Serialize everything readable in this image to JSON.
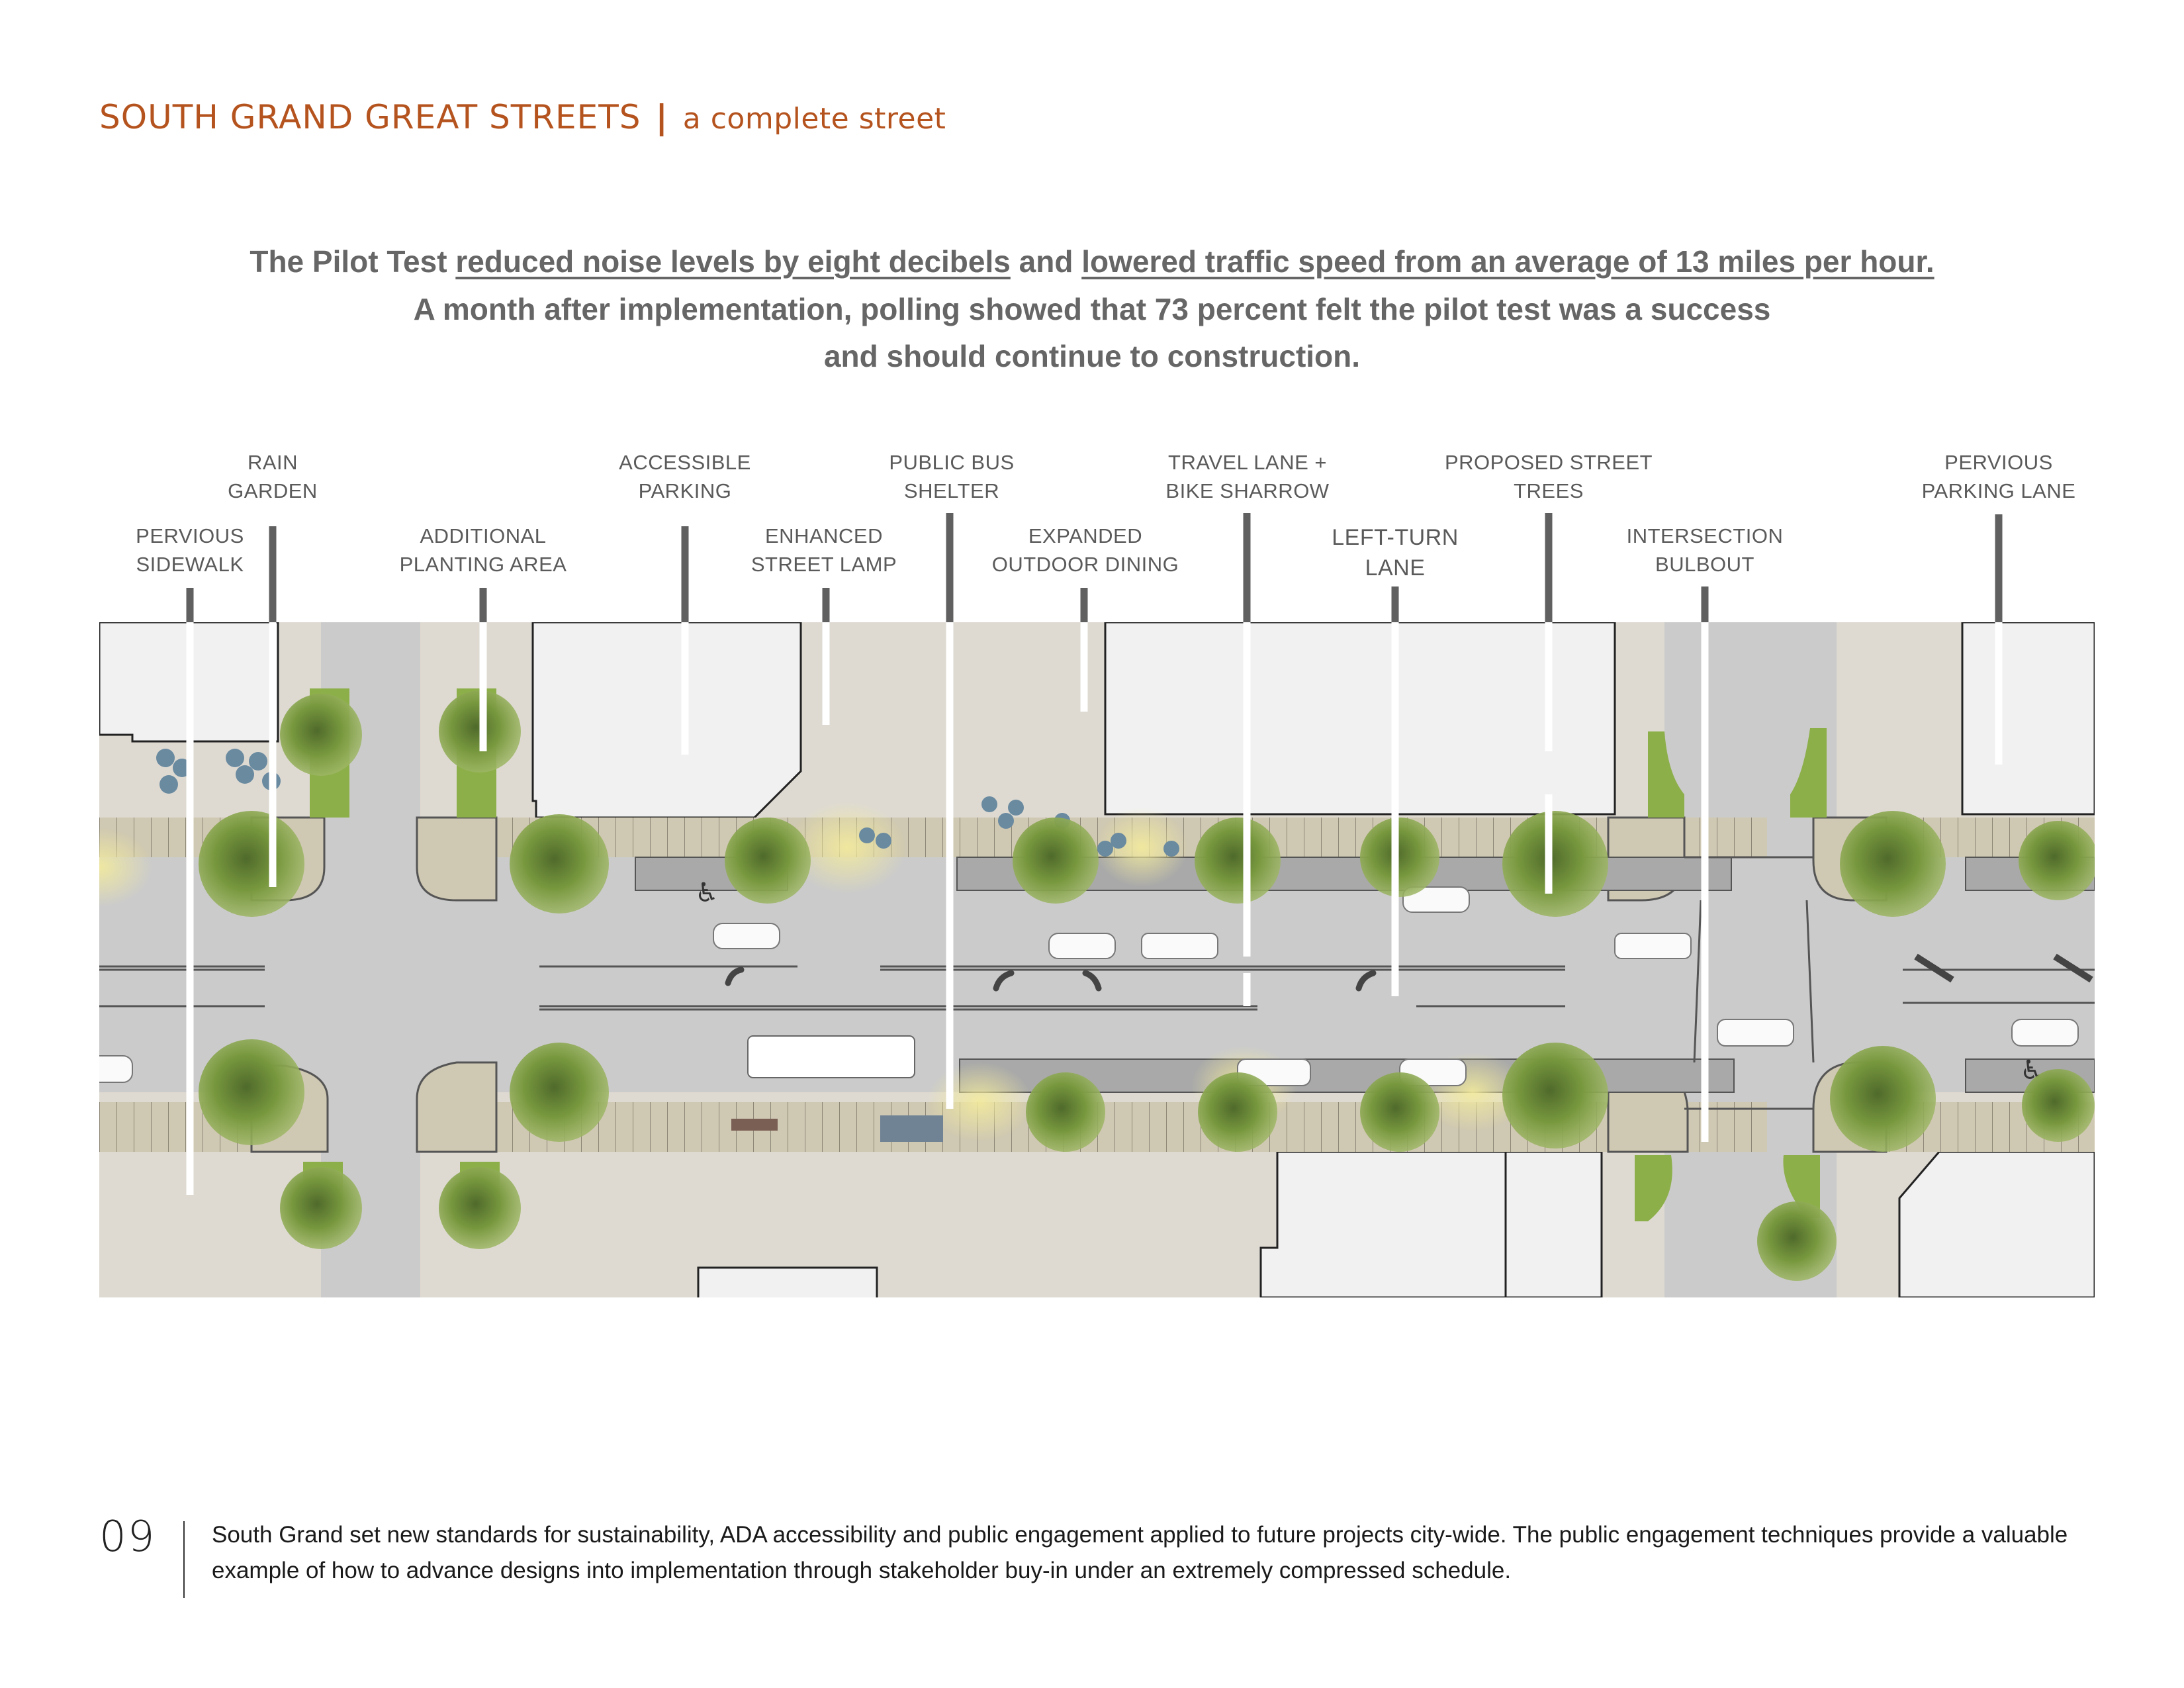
{
  "header": {
    "title": "SOUTH GRAND GREAT STREETS",
    "separator": "|",
    "subtitle": "a complete street"
  },
  "summary": {
    "line1_pre": "The Pilot Test ",
    "line1_u1": "reduced noise levels by eight decibels",
    "line1_mid": " and ",
    "line1_u2": "lowered traffic speed from an average of 13 miles per hour.",
    "line2": "A month after implementation, polling showed that 73 percent felt the pilot test was a success",
    "line3": "and should continue to construction."
  },
  "callouts": [
    {
      "id": "pervious-sidewalk",
      "line1": "PERVIOUS",
      "line2": "SIDEWALK"
    },
    {
      "id": "rain-garden",
      "line1": "RAIN",
      "line2": "GARDEN"
    },
    {
      "id": "additional-planting-area",
      "line1": "ADDITIONAL",
      "line2": "PLANTING AREA"
    },
    {
      "id": "accessible-parking",
      "line1": "ACCESSIBLE",
      "line2": "PARKING"
    },
    {
      "id": "enhanced-street-lamp",
      "line1": "ENHANCED",
      "line2": "STREET LAMP"
    },
    {
      "id": "public-bus-shelter",
      "line1": "PUBLIC BUS",
      "line2": "SHELTER"
    },
    {
      "id": "expanded-outdoor-dining",
      "line1": "EXPANDED",
      "line2": "OUTDOOR DINING"
    },
    {
      "id": "travel-lane-bike-sharrow",
      "line1": "TRAVEL LANE +",
      "line2": "BIKE SHARROW"
    },
    {
      "id": "left-turn-lane",
      "line1": "LEFT-TURN",
      "line2": "LANE"
    },
    {
      "id": "proposed-street-trees",
      "line1": "PROPOSED STREET",
      "line2": "TREES"
    },
    {
      "id": "intersection-bulbout",
      "line1": "INTERSECTION",
      "line2": "BULBOUT"
    },
    {
      "id": "pervious-parking-lane",
      "line1": "PERVIOUS",
      "line2": "PARKING LANE"
    }
  ],
  "plan": {
    "colors": {
      "road": "#cbcbcb",
      "sidewalk": "#cfc8b2",
      "building": "#f1f1f1",
      "lot": "#dedad2",
      "planting": "#8daf4a",
      "tree": "#6f8f3a",
      "parking": "#a9a9a9",
      "stripe": "#555555",
      "bench": "#6f8395",
      "table": "#6a8aa0",
      "lamp_glow": "#efe79a"
    },
    "accessible_symbol": "♿"
  },
  "footer": {
    "page_number": "09",
    "text": "South Grand set new standards for sustainability, ADA accessibility and public engagement applied to future projects city-wide. The public engagement techniques provide a valuable example of how to advance designs into implementation through stakeholder buy-in under an extremely compressed schedule."
  },
  "colors": {
    "accent": "#b5531e",
    "summary_text": "#666666",
    "label_text": "#5a5a5a"
  }
}
